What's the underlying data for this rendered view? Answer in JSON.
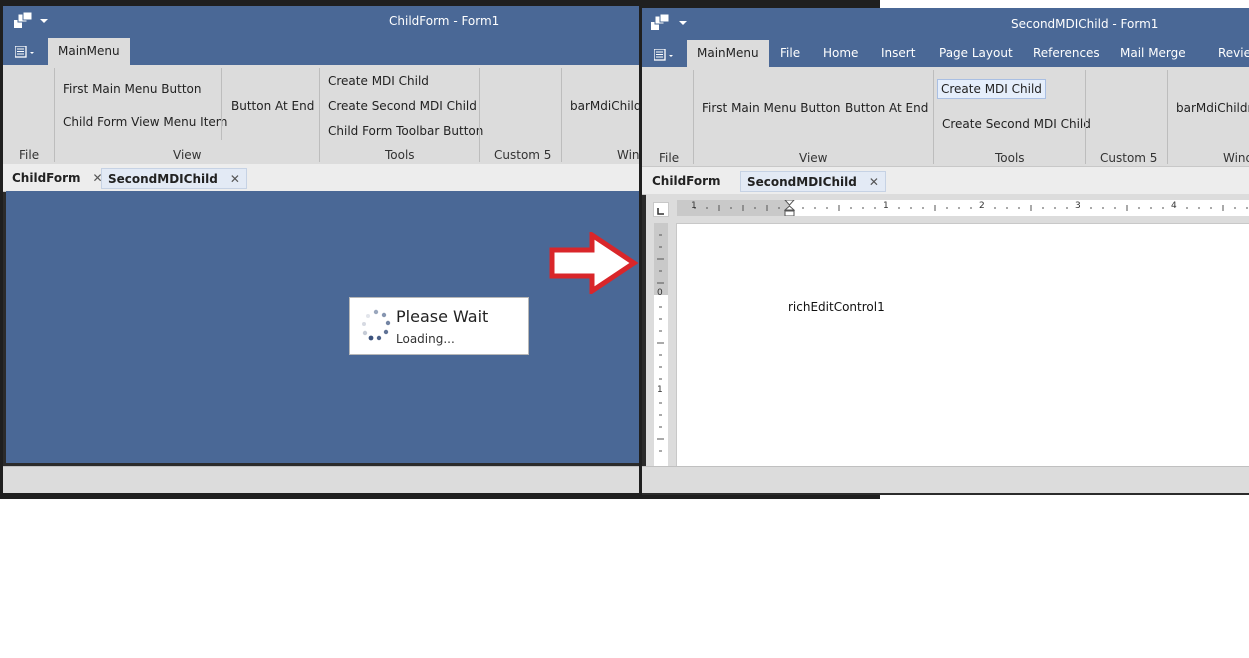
{
  "window1": {
    "title": "ChildForm - Form1",
    "ribbon_tabs": [
      "MainMenu"
    ],
    "buttons": {
      "first_main_menu": "First Main Menu Button",
      "child_form_view_menu": "Child Form View Menu Item",
      "button_at_end": "Button At End",
      "create_mdi_child": "Create MDI Child",
      "create_second_mdi_child": "Create Second MDI Child",
      "child_form_toolbar": "Child Form Toolbar Button",
      "bar_mdi_children": "barMdiChildre"
    },
    "groups": {
      "file": "File",
      "view": "View",
      "tools": "Tools",
      "custom5": "Custom 5",
      "windows": "Win"
    },
    "doc_tabs": [
      "ChildForm",
      "SecondMDIChild"
    ],
    "wait": {
      "title": "Please Wait",
      "subtitle": "Loading..."
    }
  },
  "window2": {
    "title": "SecondMDIChild - Form1",
    "ribbon_tabs": [
      "MainMenu",
      "File",
      "Home",
      "Insert",
      "Page Layout",
      "References",
      "Mail Merge",
      "Review"
    ],
    "buttons": {
      "first_main_menu": "First Main Menu Button",
      "button_at_end": "Button At End",
      "create_mdi_child": "Create MDI Child",
      "create_second_mdi_child": "Create Second MDI Child",
      "bar_mdi_children": "barMdiChildren"
    },
    "groups": {
      "file": "File",
      "view": "View",
      "tools": "Tools",
      "custom5": "Custom 5",
      "windows": "Wind"
    },
    "doc_tabs": [
      "ChildForm",
      "SecondMDIChild"
    ],
    "ruler_numbers": [
      "1",
      "1",
      "2",
      "3",
      "4"
    ],
    "vruler_numbers": [
      "0",
      "1"
    ],
    "rich_edit_text": "richEditControl1"
  },
  "colors": {
    "titlebar": "#4a6896",
    "ribbon": "#dcdcdc",
    "arrow": "#d9262a"
  },
  "icons": {
    "app": "app-window-icon",
    "dropdown": "chevron-down-icon",
    "quick_access": "quick-access-menu-icon",
    "close_tab": "close-icon",
    "spinner": "loading-spinner-icon",
    "arrow": "right-arrow-icon"
  }
}
